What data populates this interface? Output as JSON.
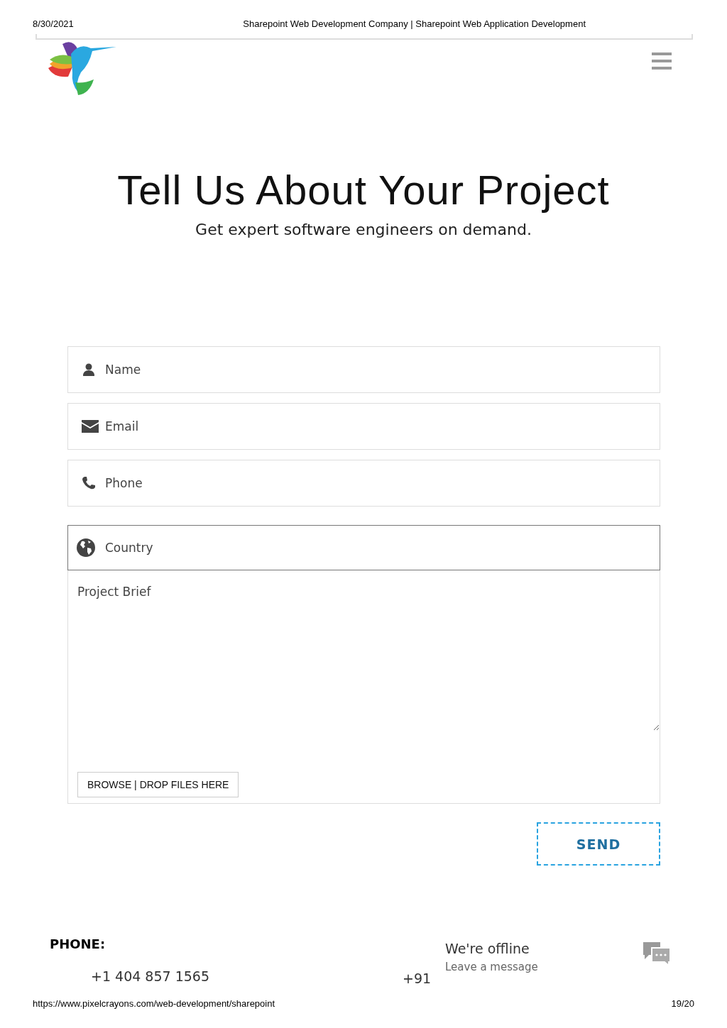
{
  "print_header": {
    "date": "8/30/2021",
    "title": "Sharepoint Web Development Company | Sharepoint Web Application Development"
  },
  "hero": {
    "title": "Tell Us About Your Project",
    "subtitle": "Get expert software engineers on demand."
  },
  "form": {
    "fields": [
      {
        "kind": "person",
        "placeholder": "Name",
        "focused": false
      },
      {
        "kind": "mail",
        "placeholder": "Email",
        "focused": false
      },
      {
        "kind": "phone",
        "placeholder": "Phone",
        "focused": false
      },
      {
        "kind": "globe",
        "placeholder": "Country",
        "focused": true
      }
    ],
    "brief": {
      "placeholder": "Project Brief"
    },
    "upload_button": "BROWSE | DROP FILES HERE",
    "send_button": "SEND"
  },
  "footer": {
    "heading": "PHONE:",
    "phones": [
      "+1 404 857 1565",
      "+91"
    ]
  },
  "chat_widget": {
    "status": "We're offline",
    "prompt": "Leave a message"
  },
  "print_footer": {
    "url": "https://www.pixelcrayons.com/web-development/sharepoint",
    "page": "19/20"
  }
}
